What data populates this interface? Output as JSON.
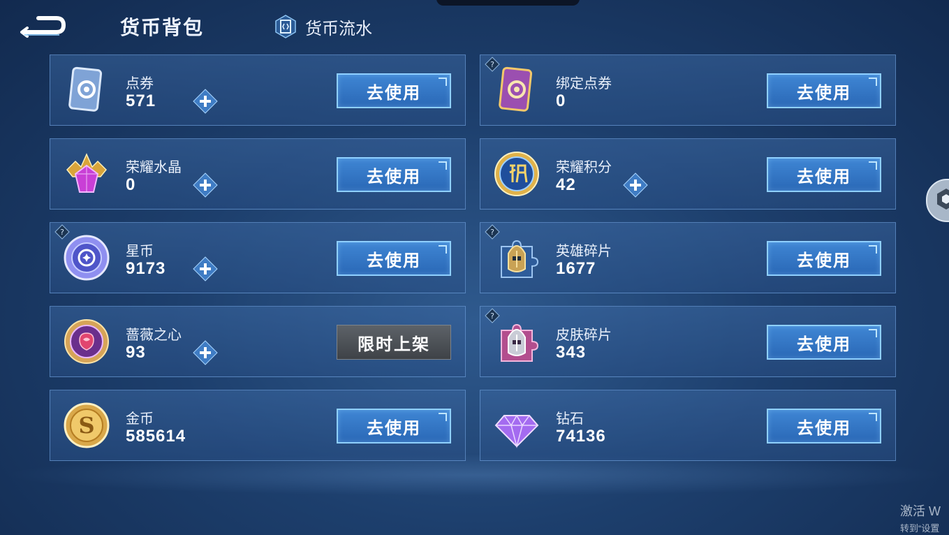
{
  "header": {
    "title": "货币背包",
    "ledger_tab": "货币流水"
  },
  "buttons": {
    "use": "去使用",
    "limited": "限时上架"
  },
  "currencies": [
    {
      "name": "点券",
      "amount": "571",
      "icon": "ticket-icon",
      "has_plus": true,
      "has_help": false,
      "action": "use"
    },
    {
      "name": "绑定点券",
      "amount": "0",
      "icon": "bound-ticket-icon",
      "has_plus": false,
      "has_help": true,
      "action": "use"
    },
    {
      "name": "荣耀水晶",
      "amount": "0",
      "icon": "glory-crystal-icon",
      "has_plus": true,
      "has_help": false,
      "action": "use"
    },
    {
      "name": "荣耀积分",
      "amount": "42",
      "icon": "glory-points-icon",
      "has_plus": true,
      "has_help": false,
      "action": "use"
    },
    {
      "name": "星币",
      "amount": "9173",
      "icon": "star-coin-icon",
      "has_plus": true,
      "has_help": true,
      "action": "use"
    },
    {
      "name": "英雄碎片",
      "amount": "1677",
      "icon": "hero-fragment-icon",
      "has_plus": false,
      "has_help": true,
      "action": "use"
    },
    {
      "name": "蔷薇之心",
      "amount": "93",
      "icon": "rose-heart-icon",
      "has_plus": true,
      "has_help": false,
      "action": "limited"
    },
    {
      "name": "皮肤碎片",
      "amount": "343",
      "icon": "skin-fragment-icon",
      "has_plus": false,
      "has_help": true,
      "action": "use"
    },
    {
      "name": "金币",
      "amount": "585614",
      "icon": "gold-coin-icon",
      "has_plus": false,
      "has_help": false,
      "action": "use"
    },
    {
      "name": "钻石",
      "amount": "74136",
      "icon": "diamond-icon",
      "has_plus": false,
      "has_help": false,
      "action": "use"
    }
  ],
  "watermark": {
    "line1": "激活 W",
    "line2": "转到“设置"
  },
  "colors": {
    "button_blue": "#3f86d4",
    "button_border": "#8fd0ff",
    "limited_gray": "#5d6268",
    "card_border": "#78aae6"
  }
}
